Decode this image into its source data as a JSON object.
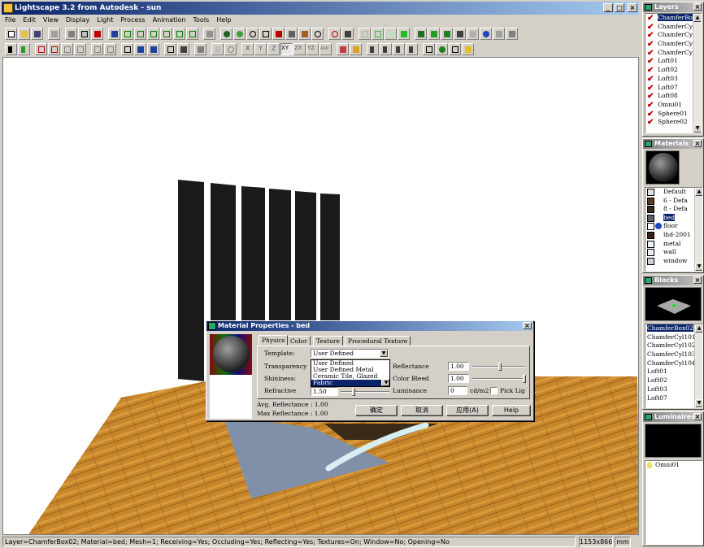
{
  "window": {
    "title": "Lightscape 3.2 from Autodesk - sun",
    "minimize": "_",
    "maximize": "□",
    "close": "×"
  },
  "menu": [
    "File",
    "Edit",
    "View",
    "Display",
    "Light",
    "Process",
    "Animation",
    "Tools",
    "Help"
  ],
  "axis_buttons": [
    "X",
    "Y",
    "Z",
    "XY",
    "ZX",
    "YZ",
    "A/W"
  ],
  "status": {
    "text": "Layer=ChamferBox02; Material=bed; Mesh=1; Receiving=Yes; Occluding=Yes; Reflecting=Yes; Textures=On; Window=No; Opening=No",
    "resolution": "1153x866",
    "unit": "mm"
  },
  "layers_panel": {
    "title": "Layers",
    "close": "×",
    "items": [
      "ChamferBox0",
      "ChamferCyl10",
      "ChamferCyl10",
      "ChamferCyl10",
      "ChamferCyl10",
      "Loft01",
      "Loft02",
      "Loft03",
      "Loft07",
      "Loft08",
      "Omni01",
      "Sphere01",
      "Sphere02"
    ],
    "selected_index": 0
  },
  "materials_panel": {
    "title": "Materials",
    "close": "×",
    "items": [
      {
        "label": "Default",
        "color": "#e0e0e0"
      },
      {
        "label": "6 - Defa",
        "color": "#5a3a20"
      },
      {
        "label": "8 - Defa",
        "color": "#3a2a1a"
      },
      {
        "label": "bed",
        "color": "#606060"
      },
      {
        "label": "floor",
        "color": "#ffffff"
      },
      {
        "label": "lhd-2001",
        "color": "#3a2010"
      },
      {
        "label": "metal",
        "color": "#e8f0f8"
      },
      {
        "label": "wall",
        "color": "#f0f0f0"
      },
      {
        "label": "window",
        "color": "#d0d0d0"
      }
    ],
    "selected_index": 3
  },
  "blocks_panel": {
    "title": "Blocks",
    "close": "×",
    "items": [
      "ChamferBox02",
      "ChamferCyl101",
      "ChamferCyl102",
      "ChamferCyl103",
      "ChamferCyl104",
      "Loft01",
      "Loft02",
      "Loft03",
      "Loft07"
    ],
    "selected_index": 0
  },
  "luminaires_panel": {
    "title": "Luminaires",
    "close": "×",
    "items": [
      "Omni01"
    ]
  },
  "dialog": {
    "title": "Material Properties - bed",
    "close": "×",
    "tabs": [
      "Physics",
      "Color",
      "Texture",
      "Procedural Texture"
    ],
    "template_label": "Template:",
    "template_value": "User Defined",
    "template_options": [
      "User Defined",
      "User Defined Metal",
      "Ceramic Tile, Glazed",
      "Fabric"
    ],
    "template_selected": 3,
    "transparency_label": "Transparency",
    "shininess_label": "Shininess:",
    "refractive_label": "Refractive",
    "refractive_value": "1.50",
    "reflectance_label": "Reflectance",
    "reflectance_value": "1.00",
    "color_bleed_label": "Color Bleed",
    "color_bleed_value": "1.00",
    "luminance_label": "Luminance",
    "luminance_value": "0",
    "luminance_unit": "cd/m2",
    "pick_light_label": "Pick Lig",
    "avg_reflectance": "Avg. Reflectance : 1.00",
    "max_reflectance": "Max Reflectance : 1.00",
    "ok": "确定",
    "cancel": "取消",
    "apply": "应用(A)",
    "help": "Help"
  },
  "colors": {
    "titlebar": "#0a246a",
    "floor": "#c8862a",
    "panels_black": "#1a1a1a",
    "rug": "#8090a8"
  }
}
